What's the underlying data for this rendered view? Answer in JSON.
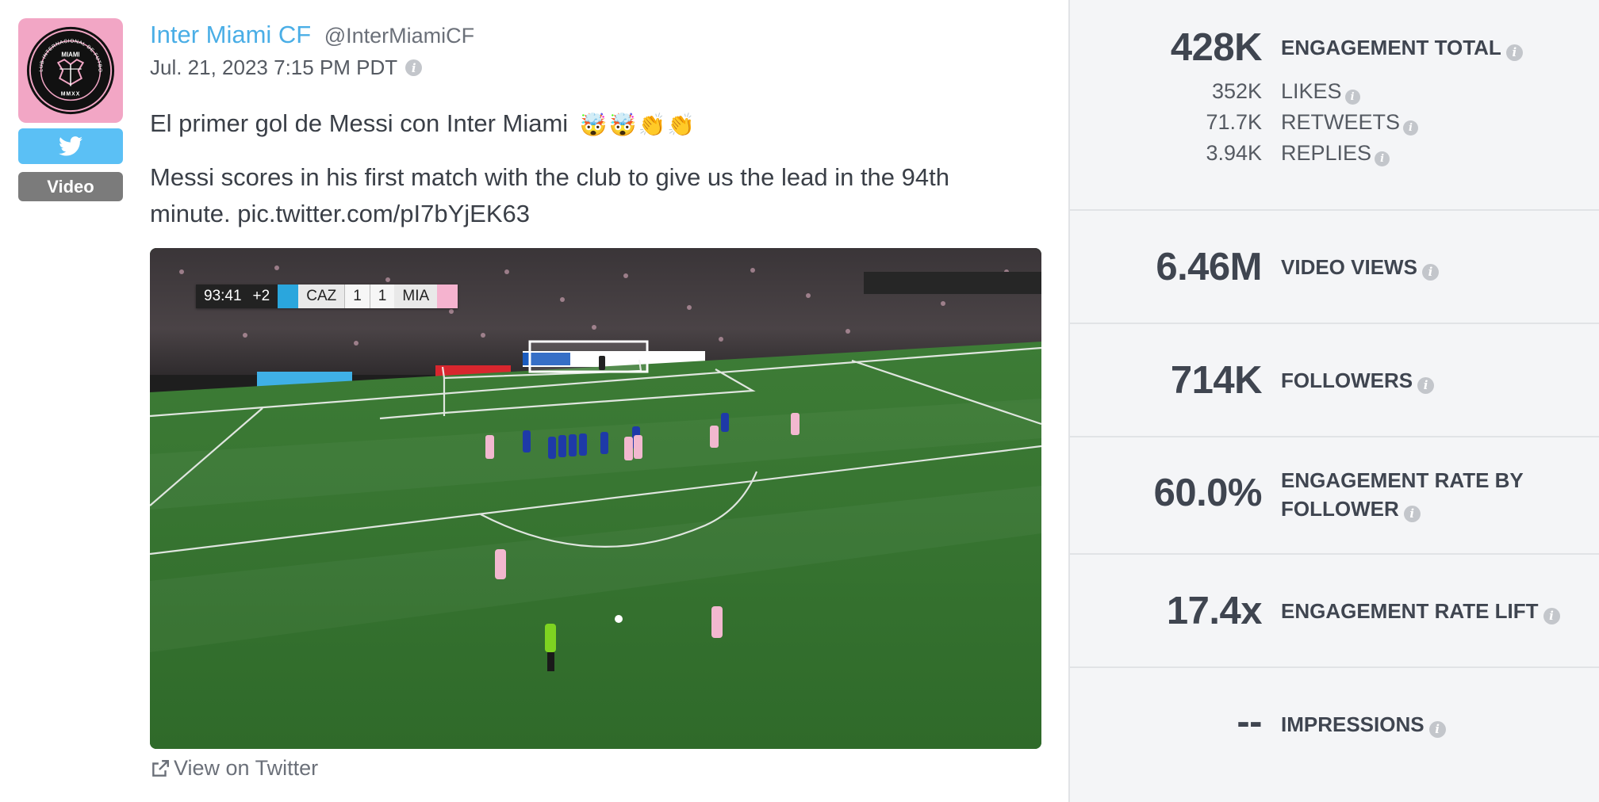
{
  "post": {
    "account_name": "Inter Miami CF",
    "handle": "@InterMiamiCF",
    "timestamp": "Jul. 21, 2023 7:15 PM PDT",
    "platform_icon": "twitter-bird-icon",
    "type_badge": "Video",
    "text_line1": "El primer gol de Messi con Inter Miami",
    "text_emojis": [
      "🤯",
      "🤯",
      "👏",
      "👏"
    ],
    "text_line2": "Messi scores in his first match with the club to give us the lead in the 94th minute. pic.twitter.com/pI7bYjEK63",
    "view_link": "View on Twitter",
    "colors": {
      "brand_pink": "#f2a6c5",
      "twitter_blue": "#5bc0f5",
      "link_blue": "#4aaee6",
      "badge_gray": "#7b7b7b"
    },
    "avatar": {
      "crest_top_text": "CLUB INTERNACIONAL DE FUTBOL",
      "crest_center_text": "MIAMI",
      "crest_bottom_text": "MMXX"
    },
    "media": {
      "scorebug": {
        "clock": "93:41",
        "added_time": "+2",
        "home_team": "CAZ",
        "home_score": "1",
        "away_score": "1",
        "away_team": "MIA"
      }
    }
  },
  "metrics": {
    "engagement_total": {
      "value": "428K",
      "label": "ENGAGEMENT TOTAL",
      "breakdown": [
        {
          "value": "352K",
          "label": "LIKES"
        },
        {
          "value": "71.7K",
          "label": "RETWEETS"
        },
        {
          "value": "3.94K",
          "label": "REPLIES"
        }
      ]
    },
    "video_views": {
      "value": "6.46M",
      "label": "VIDEO VIEWS"
    },
    "followers": {
      "value": "714K",
      "label": "FOLLOWERS"
    },
    "engagement_rate": {
      "value": "60.0%",
      "label_line1": "ENGAGEMENT RATE BY",
      "label_line2": "FOLLOWER"
    },
    "engagement_rate_lift": {
      "value": "17.4x",
      "label": "ENGAGEMENT RATE LIFT"
    },
    "impressions": {
      "value": "--",
      "label": "IMPRESSIONS"
    }
  }
}
